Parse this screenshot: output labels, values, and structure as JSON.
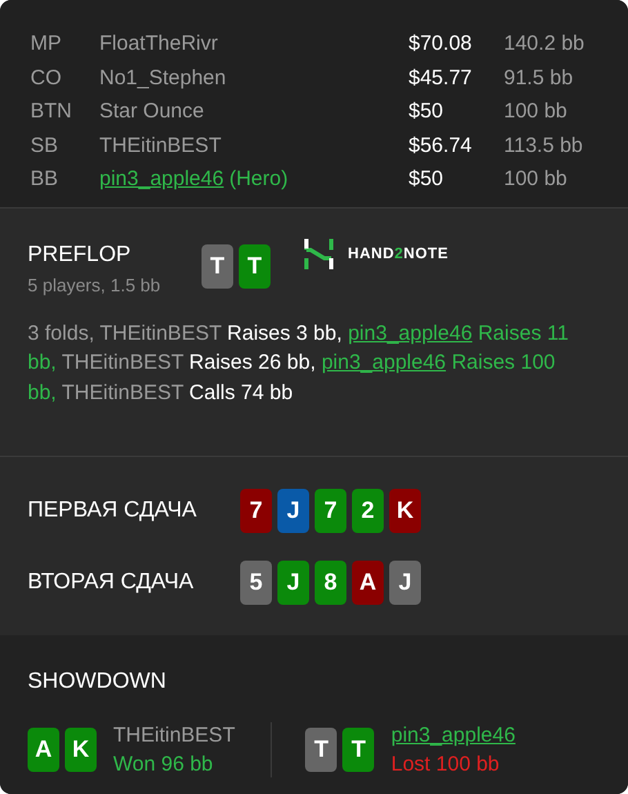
{
  "players": [
    {
      "position": "MP",
      "name": "FloatTheRivr",
      "hero": false,
      "stack": "$70.08",
      "bb": "140.2 bb"
    },
    {
      "position": "CO",
      "name": "No1_Stephen",
      "hero": false,
      "stack": "$45.77",
      "bb": "91.5 bb"
    },
    {
      "position": "BTN",
      "name": "Star Ounce",
      "hero": false,
      "stack": "$50",
      "bb": "100 bb"
    },
    {
      "position": "SB",
      "name": "THEitinBEST",
      "hero": false,
      "stack": "$56.74",
      "bb": "113.5 bb"
    },
    {
      "position": "BB",
      "name": "pin3_apple46",
      "hero": true,
      "hero_label": "(Hero)",
      "stack": "$50",
      "bb": "100 bb"
    }
  ],
  "preflop": {
    "title": "PREFLOP",
    "subtitle": "5 players, 1.5 bb",
    "cards": [
      {
        "rank": "T",
        "color": "#666666"
      },
      {
        "rank": "T",
        "color": "#0b8a0b"
      }
    ],
    "logo": {
      "before": "HAND",
      "accent": "2",
      "after": "NOTE"
    },
    "actions": [
      {
        "text": "3 folds, THEitinBEST",
        "kind": "player"
      },
      {
        "text": "Raises 3 bb,",
        "kind": "action"
      },
      {
        "text": "pin3_apple46",
        "kind": "hero"
      },
      {
        "text": "Raises 11 bb,",
        "kind": "hero_action"
      },
      {
        "text": "THEitinBEST",
        "kind": "player"
      },
      {
        "text": "Raises 26 bb,",
        "kind": "action"
      },
      {
        "text": "pin3_apple46",
        "kind": "hero"
      },
      {
        "text": "Raises 100 bb,",
        "kind": "hero_action"
      },
      {
        "text": "THEitinBEST",
        "kind": "player"
      },
      {
        "text": "Calls 74 bb",
        "kind": "action"
      }
    ]
  },
  "boards": [
    {
      "label": "ПЕРВАЯ СДАЧА",
      "cards": [
        {
          "rank": "7",
          "color": "#8b0000"
        },
        {
          "rank": "J",
          "color": "#0a5aa8"
        },
        {
          "rank": "7",
          "color": "#0b8a0b"
        },
        {
          "rank": "2",
          "color": "#0b8a0b"
        },
        {
          "rank": "K",
          "color": "#8b0000"
        }
      ]
    },
    {
      "label": "ВТОРАЯ СДАЧА",
      "cards": [
        {
          "rank": "5",
          "color": "#666666"
        },
        {
          "rank": "J",
          "color": "#0b8a0b"
        },
        {
          "rank": "8",
          "color": "#0b8a0b"
        },
        {
          "rank": "A",
          "color": "#8b0000"
        },
        {
          "rank": "J",
          "color": "#666666"
        }
      ]
    }
  ],
  "showdown": {
    "title": "SHOWDOWN",
    "hands": [
      {
        "cards": [
          {
            "rank": "A",
            "color": "#0b8a0b"
          },
          {
            "rank": "K",
            "color": "#0b8a0b"
          }
        ],
        "name": "THEitinBEST",
        "hero": false,
        "result": "Won 96 bb",
        "won": true
      },
      {
        "cards": [
          {
            "rank": "T",
            "color": "#666666"
          },
          {
            "rank": "T",
            "color": "#0b8a0b"
          }
        ],
        "name": "pin3_apple46",
        "hero": true,
        "result": "Lost 100 bb",
        "won": false
      }
    ]
  }
}
